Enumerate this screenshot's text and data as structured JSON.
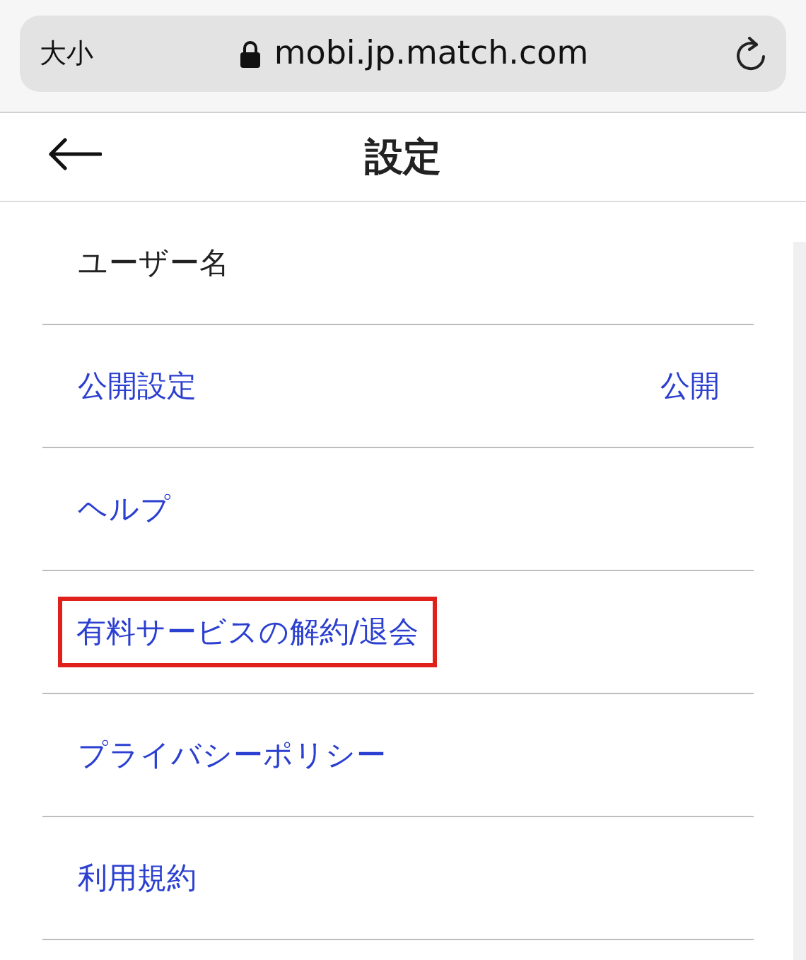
{
  "browser_bar": {
    "text_size_button": "大小",
    "url": "mobi.jp.match.com"
  },
  "header": {
    "title": "設定"
  },
  "items": [
    {
      "label": "ユーザー名",
      "kind": "plain",
      "highlighted": false
    },
    {
      "label": "公開設定",
      "kind": "link",
      "value": "公開",
      "highlighted": false
    },
    {
      "label": "ヘルプ",
      "kind": "link",
      "highlighted": false
    },
    {
      "label": "有料サービスの解約/退会",
      "kind": "link",
      "highlighted": true
    },
    {
      "label": "プライバシーポリシー",
      "kind": "link",
      "highlighted": false
    },
    {
      "label": "利用規約",
      "kind": "link",
      "highlighted": false
    }
  ]
}
